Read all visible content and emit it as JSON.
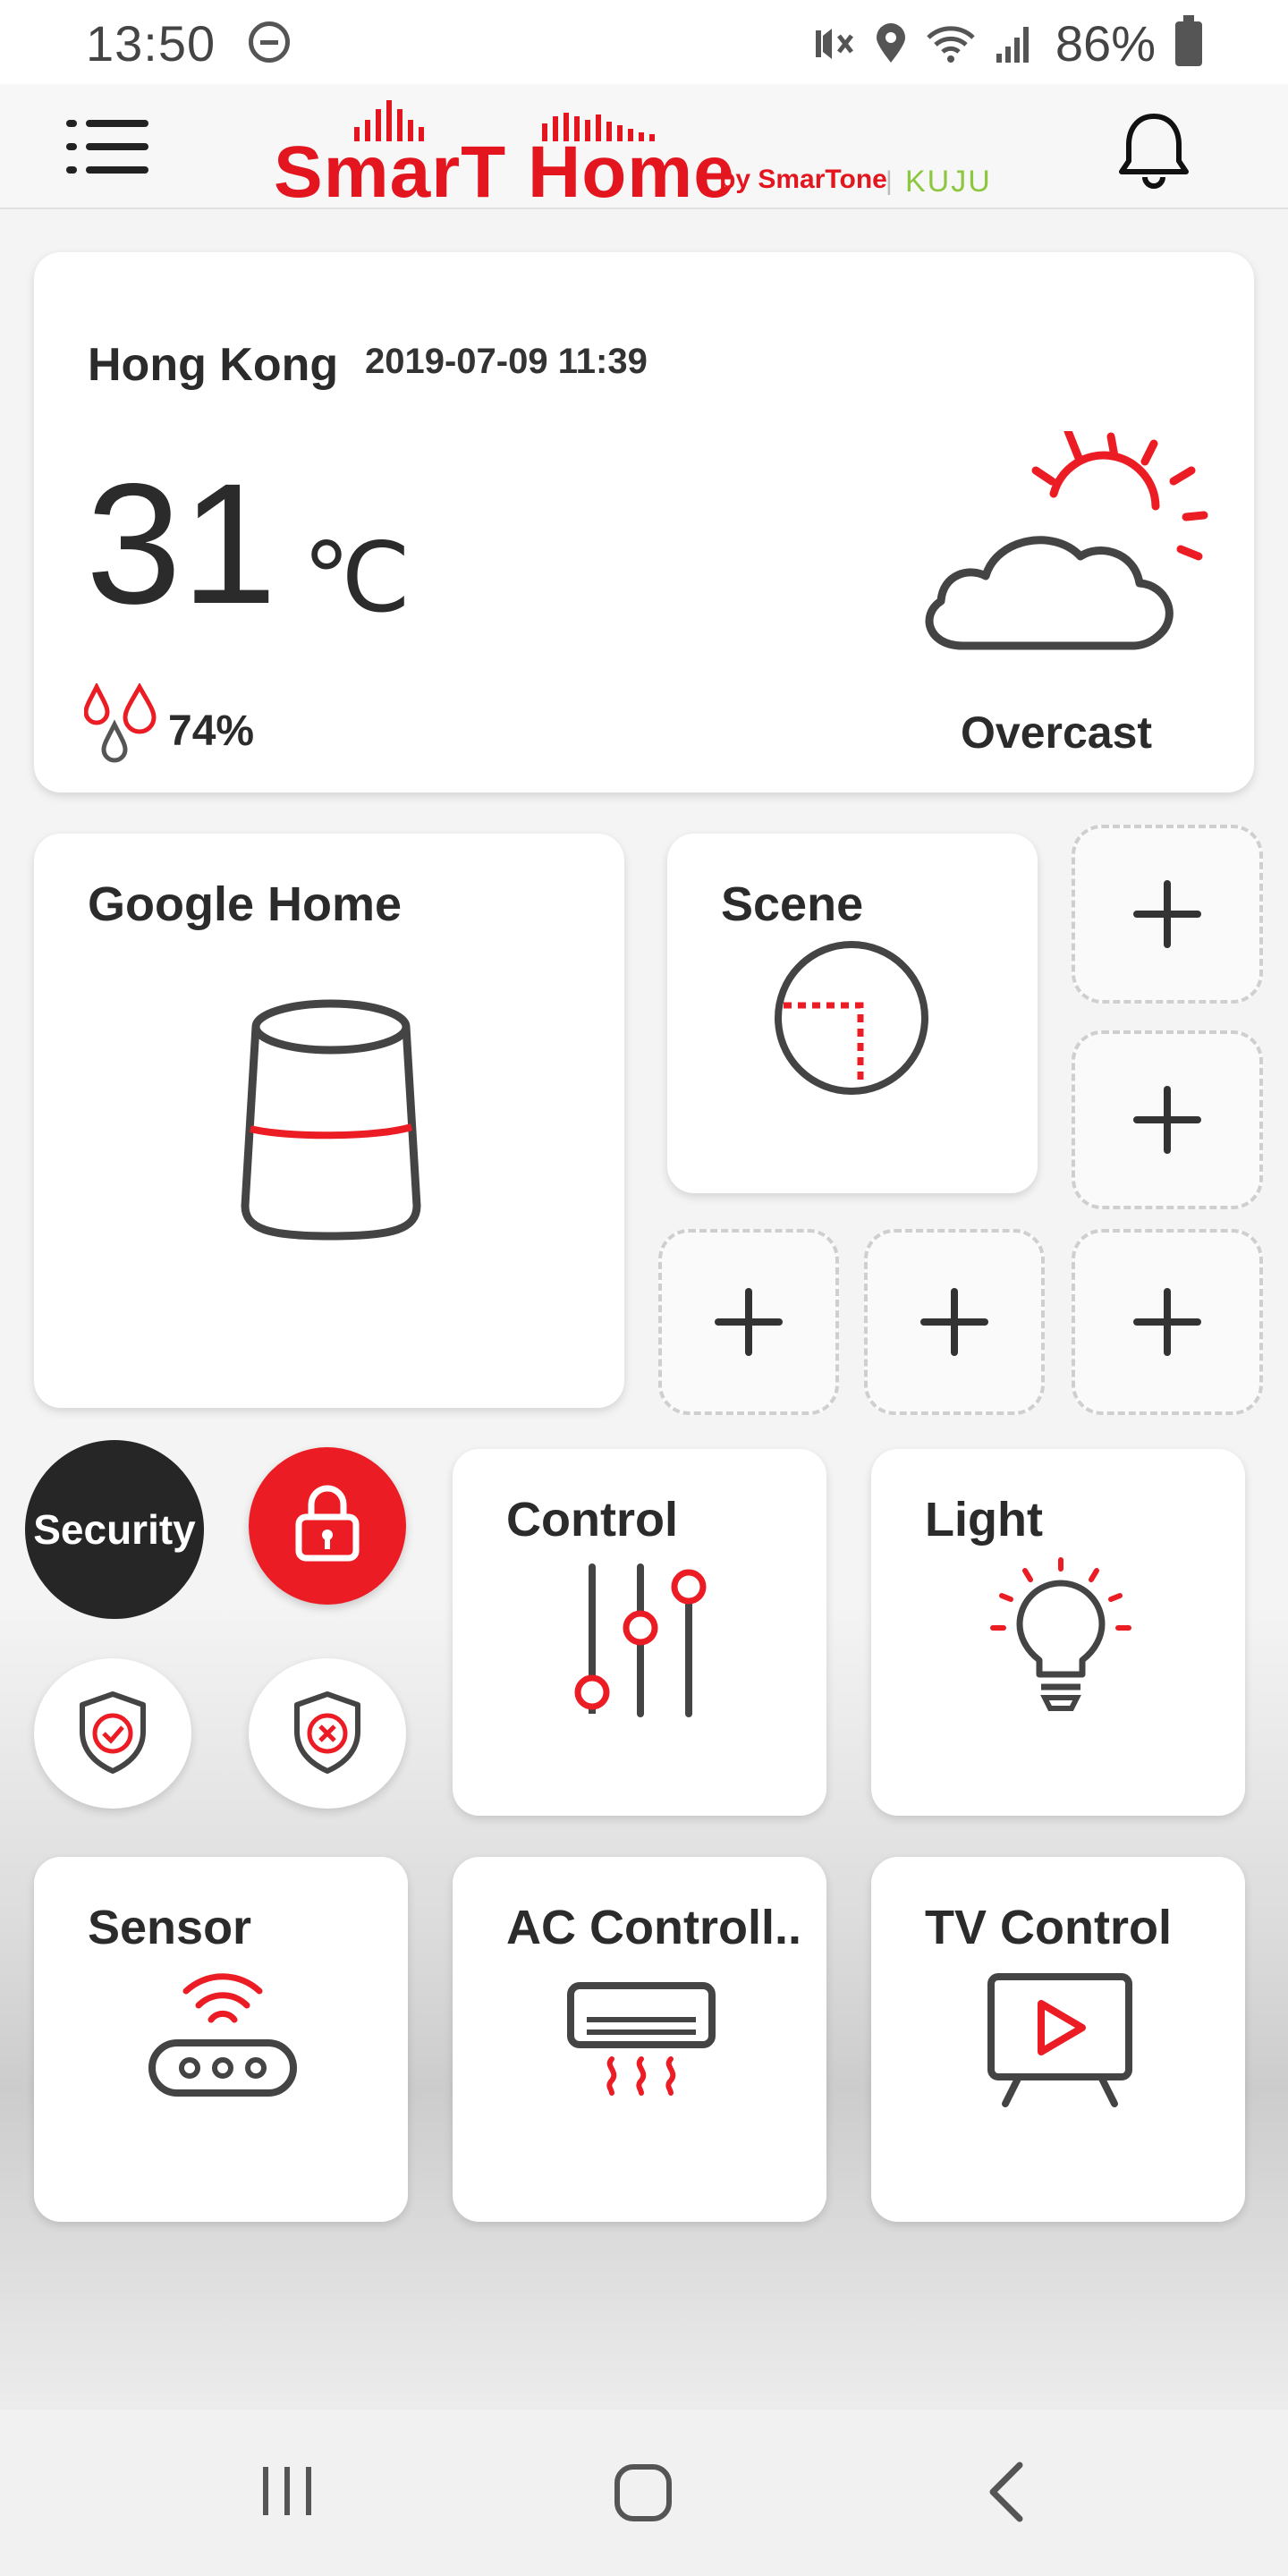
{
  "status_bar": {
    "time": "13:50",
    "battery": "86%",
    "icons": [
      "do-not-disturb-icon",
      "mute-icon",
      "location-icon",
      "wifi-icon",
      "signal-icon",
      "battery-icon"
    ]
  },
  "header": {
    "logo_main": "SmarT Home",
    "logo_by": "by SmarTone",
    "logo_sep": "|",
    "logo_partner": "KUJU",
    "icons": [
      "menu-icon",
      "bell-icon"
    ]
  },
  "weather": {
    "city": "Hong Kong",
    "datetime": "2019-07-09 11:39",
    "temperature": "31",
    "unit": "℃",
    "humidity": "74%",
    "condition": "Overcast",
    "icons": [
      "humidity-icon",
      "partly-cloudy-icon"
    ]
  },
  "tiles": {
    "google_home": "Google Home",
    "scene": "Scene",
    "control": "Control",
    "light": "Light",
    "sensor": "Sensor",
    "ac": "AC Controll..",
    "tv": "TV Control"
  },
  "security": {
    "label": "Security",
    "icons": [
      "lock-icon",
      "shield-check-icon",
      "shield-x-icon"
    ]
  },
  "colors": {
    "accent": "#ec1c24",
    "brand_red": "#e3161f",
    "brand_green": "#8dc63f",
    "dark": "#262626"
  }
}
